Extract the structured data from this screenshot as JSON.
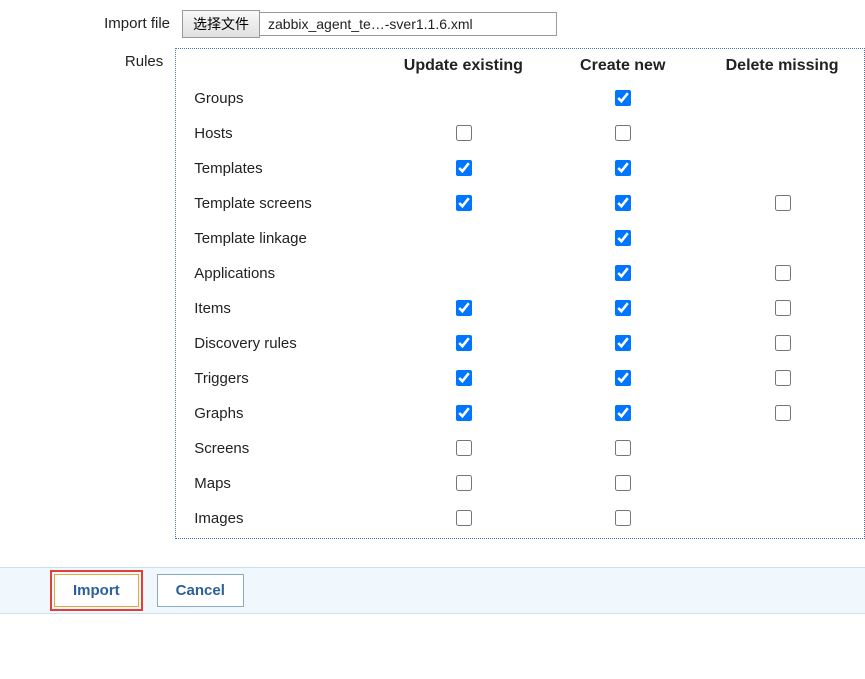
{
  "labels": {
    "import_file": "Import file",
    "rules": "Rules",
    "file_button": "选择文件",
    "file_name": "zabbix_agent_te…-sver1.1.6.xml"
  },
  "headers": {
    "blank": "",
    "update_existing": "Update existing",
    "create_new": "Create new",
    "delete_missing": "Delete missing"
  },
  "rules": [
    {
      "label": "Groups",
      "update": null,
      "create": true,
      "delete": null
    },
    {
      "label": "Hosts",
      "update": false,
      "create": false,
      "delete": null
    },
    {
      "label": "Templates",
      "update": true,
      "create": true,
      "delete": null
    },
    {
      "label": "Template screens",
      "update": true,
      "create": true,
      "delete": false
    },
    {
      "label": "Template linkage",
      "update": null,
      "create": true,
      "delete": null
    },
    {
      "label": "Applications",
      "update": null,
      "create": true,
      "delete": false
    },
    {
      "label": "Items",
      "update": true,
      "create": true,
      "delete": false
    },
    {
      "label": "Discovery rules",
      "update": true,
      "create": true,
      "delete": false
    },
    {
      "label": "Triggers",
      "update": true,
      "create": true,
      "delete": false
    },
    {
      "label": "Graphs",
      "update": true,
      "create": true,
      "delete": false
    },
    {
      "label": "Screens",
      "update": false,
      "create": false,
      "delete": null
    },
    {
      "label": "Maps",
      "update": false,
      "create": false,
      "delete": null
    },
    {
      "label": "Images",
      "update": false,
      "create": false,
      "delete": null
    }
  ],
  "buttons": {
    "import": "Import",
    "cancel": "Cancel"
  }
}
